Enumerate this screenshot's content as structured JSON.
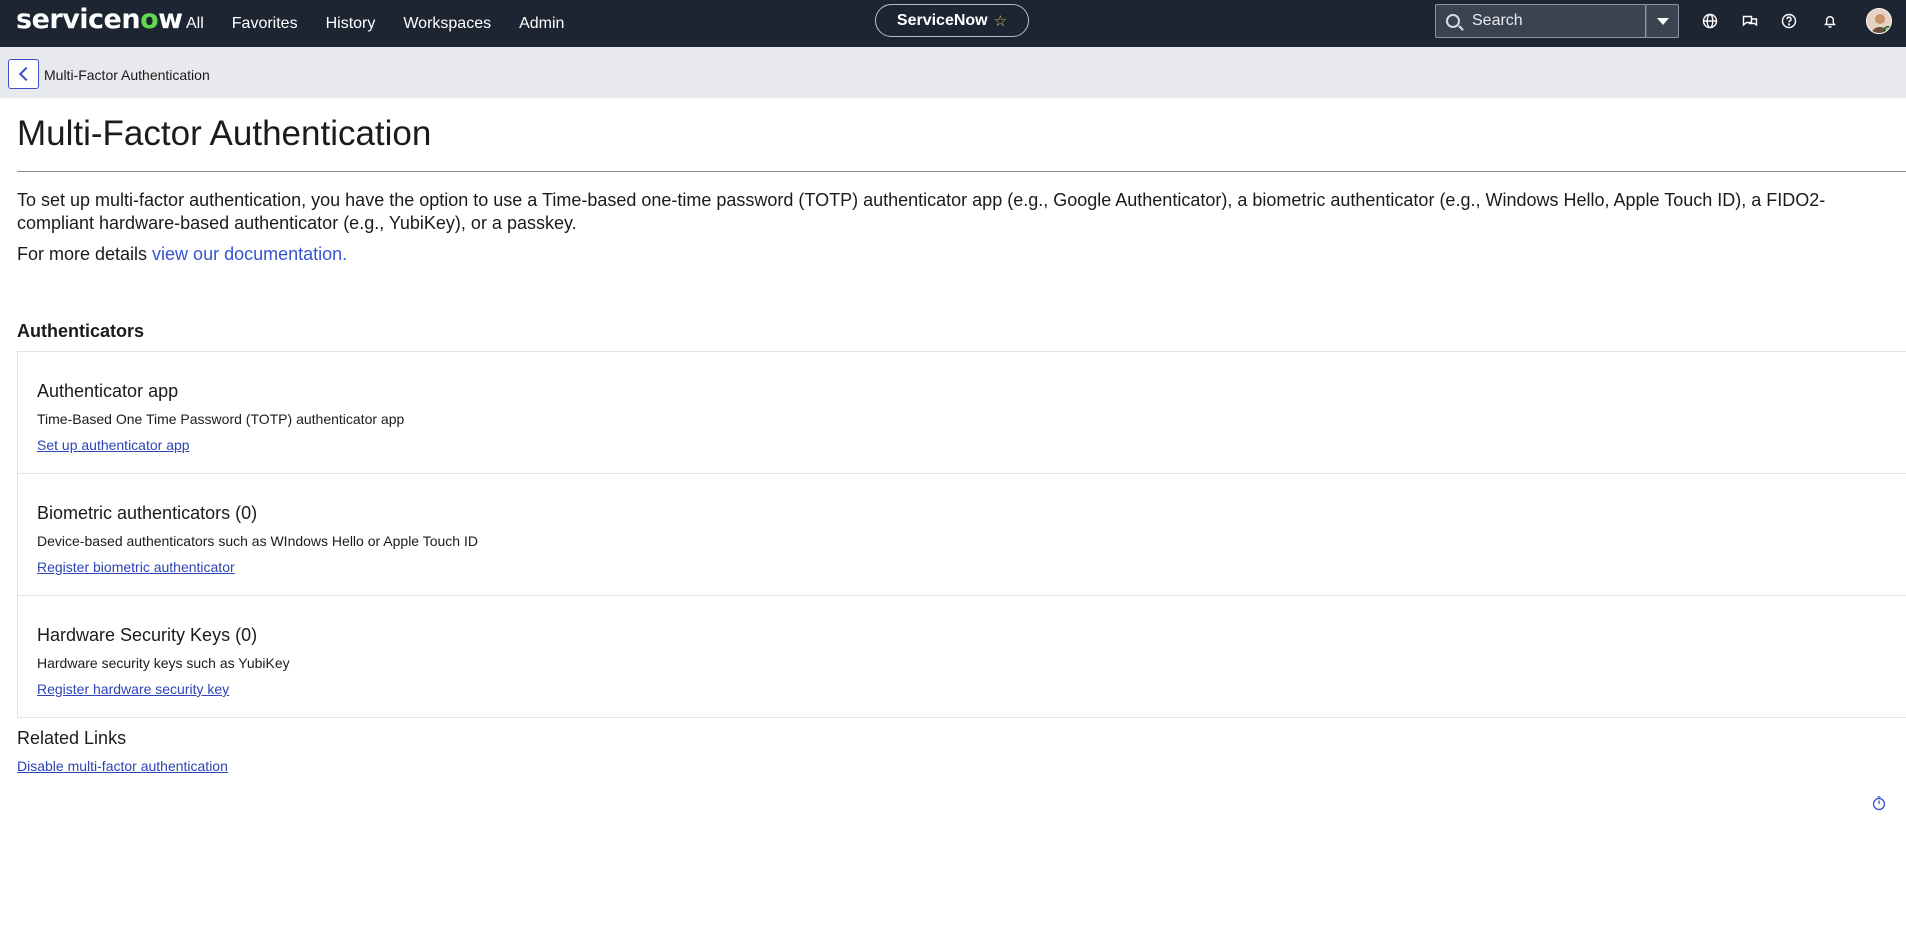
{
  "nav": {
    "logo_text_a": "servicen",
    "logo_text_o": "o",
    "logo_text_b": "w",
    "items": [
      "All",
      "Favorites",
      "History",
      "Workspaces",
      "Admin"
    ],
    "pill_label": "ServiceNow",
    "search_placeholder": "Search",
    "icons": [
      "globe-icon",
      "chat-icon",
      "help-icon",
      "bell-icon"
    ]
  },
  "subheader": {
    "title": "Multi-Factor Authentication"
  },
  "main": {
    "title": "Multi-Factor Authentication",
    "intro": "To set up multi-factor authentication, you have the option to use a Time-based one-time password (TOTP) authenticator app (e.g., Google Authenticator), a biometric authenticator (e.g., Windows Hello, Apple Touch ID), a FIDO2-compliant hardware-based authenticator (e.g., YubiKey), or a passkey.",
    "more_prefix": "For more details ",
    "more_link": "view our documentation.",
    "section_title": "Authenticators",
    "cards": [
      {
        "title": "Authenticator app",
        "description": "Time-Based One Time Password (TOTP) authenticator app",
        "link": "Set up authenticator app"
      },
      {
        "title": "Biometric authenticators (0)",
        "description": "Device-based authenticators such as WIndows Hello or Apple Touch ID",
        "link": "Register biometric authenticator"
      },
      {
        "title": "Hardware Security Keys (0)",
        "description": "Hardware security keys such as YubiKey",
        "link": "Register hardware security key"
      }
    ],
    "related_title": "Related Links",
    "related_link": "Disable multi-factor authentication"
  },
  "colors": {
    "nav_bg": "#1d2432",
    "accent_green": "#62d84e",
    "link": "#3653d4"
  }
}
